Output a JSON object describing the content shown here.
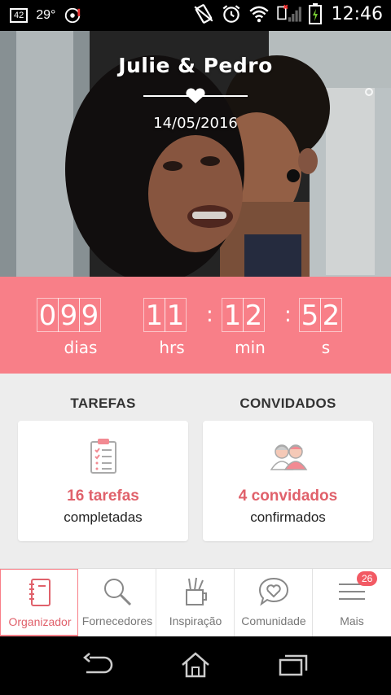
{
  "status_bar": {
    "badge": "42",
    "temperature": "29°",
    "time": "12:46"
  },
  "hero": {
    "names": "Julie & Pedro",
    "date": "14/05/2016"
  },
  "countdown": {
    "days_digits": [
      "0",
      "9",
      "9"
    ],
    "hours_digits": [
      "1",
      "1"
    ],
    "minutes_digits": [
      "1",
      "2"
    ],
    "seconds_digits": [
      "5",
      "2"
    ],
    "days_label": "dias",
    "hours_label": "hrs",
    "minutes_label": "min",
    "seconds_label": "s",
    "colon": ":"
  },
  "tasks": {
    "title": "TAREFAS",
    "count": "16 tarefas",
    "sub": "completadas",
    "icon": "clipboard-checklist-icon"
  },
  "guests": {
    "title": "CONVIDADOS",
    "count": "4 convidados",
    "sub": "confirmados",
    "icon": "couple-icon"
  },
  "nav": {
    "items": [
      {
        "label": "Organizador",
        "icon": "notebook-icon",
        "active": true
      },
      {
        "label": "Fornecedores",
        "icon": "search-icon",
        "active": false
      },
      {
        "label": "Inspiração",
        "icon": "pencil-cup-icon",
        "active": false
      },
      {
        "label": "Comunidade",
        "icon": "heart-chat-icon",
        "active": false
      },
      {
        "label": "Mais",
        "icon": "menu-icon",
        "active": false,
        "badge": "26"
      }
    ]
  },
  "colors": {
    "accent": "#f87f88",
    "accent_text": "#e0616b"
  }
}
